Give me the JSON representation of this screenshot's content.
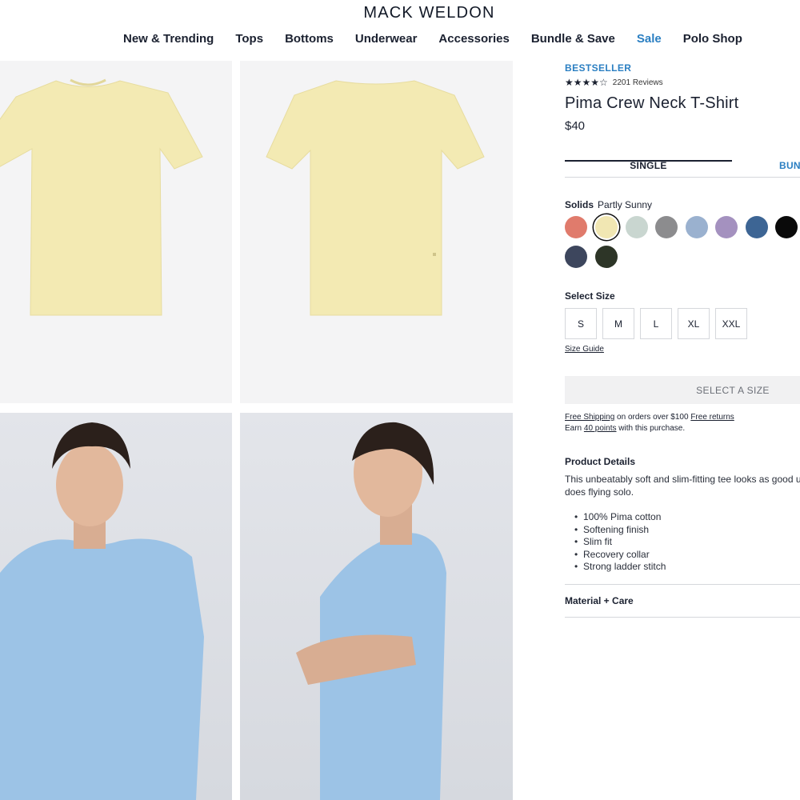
{
  "header": {
    "brand": "MACK WELDON",
    "nav": [
      "New & Trending",
      "Tops",
      "Bottoms",
      "Underwear",
      "Accessories",
      "Bundle & Save",
      "Sale",
      "Polo Shop"
    ]
  },
  "product": {
    "badge": "BESTSELLER",
    "stars_filled": "★★★★",
    "stars_empty": "☆",
    "rating": 4,
    "reviews": "2201 Reviews",
    "title": "Pima Crew Neck T-Shirt",
    "price": "$40",
    "tabs": {
      "single": "SINGLE",
      "bundle": "BUN"
    },
    "solids_label": "Solids",
    "selected_color": "Partly Sunny",
    "swatch_colors": [
      "#e07b6c",
      "#f1e7b3",
      "#c9d6d0",
      "#8c8c8e",
      "#9ab1cf",
      "#a491bf",
      "#3d6594",
      "#0a0a0a",
      "#3d465d",
      "#2d3527"
    ],
    "size_label": "Select Size",
    "sizes": [
      "S",
      "M",
      "L",
      "XL",
      "XXL"
    ],
    "size_guide": "Size Guide",
    "select_button": "SELECT A SIZE",
    "shipping": {
      "free_shipping": "Free Shipping",
      "orders_text": " on orders over $100 ",
      "free_returns": "Free returns",
      "earn_pre": "Earn ",
      "points": "40 points",
      "earn_post": " with this purchase."
    },
    "details_title": "Product Details",
    "details_text": "This unbeatably soft and slim-fitting tee looks as good u does flying solo.",
    "features": [
      "100% Pima cotton",
      "Softening finish",
      "Slim fit",
      "Recovery collar",
      "Strong ladder stitch"
    ],
    "material_care": "Material + Care"
  },
  "colors": {
    "accent": "#2b7fc2",
    "tee_yellow": "#f3eab3",
    "tee_blue": "#9cc3e6"
  },
  "icons": [
    "star-icon"
  ]
}
